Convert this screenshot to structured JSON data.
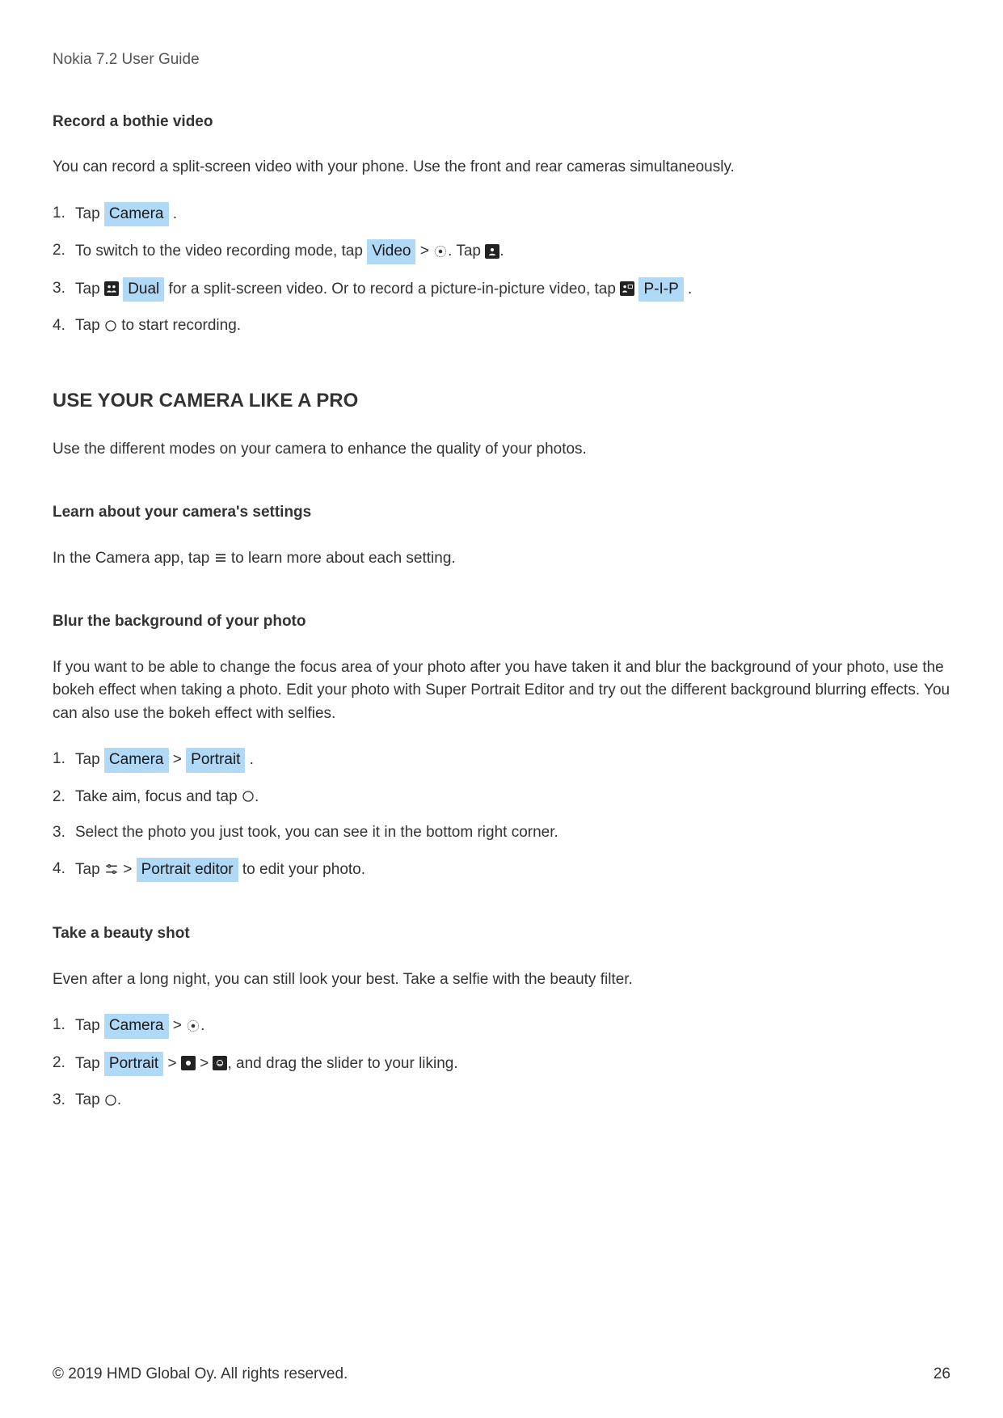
{
  "header": {
    "guide_title": "Nokia 7.2 User Guide"
  },
  "section_bothie": {
    "title": "Record a bothie video",
    "intro": "You can record a split-screen video with your phone. Use the front and rear cameras simultaneously.",
    "step1_tap": "Tap ",
    "step1_chip": "Camera",
    "step1_end": " .",
    "step2_pre": "To switch to the video recording mode, tap ",
    "step2_chip": "Video",
    "step2_mid": " > ",
    "step2_tap": ". Tap ",
    "step2_end": ".",
    "step3_pre": "Tap ",
    "step3_chip1": "Dual",
    "step3_mid": " for a split-screen video. Or to record a picture-in-picture video, tap ",
    "step3_chip2": "P-I-P",
    "step3_end": " .",
    "step4_pre": "Tap ",
    "step4_end": " to start recording."
  },
  "section_pro": {
    "title": "USE YOUR CAMERA LIKE A PRO",
    "intro": "Use the different modes on your camera to enhance the quality of your photos."
  },
  "section_settings": {
    "title": "Learn about your camera's settings",
    "line_pre": "In the Camera app, tap ",
    "line_post": " to learn more about each setting."
  },
  "section_blur": {
    "title": "Blur the background of your photo",
    "intro": "If you want to be able to change the focus area of your photo after you have taken it and blur the background of your photo, use the bokeh effect when taking a photo. Edit your photo with Super Portrait Editor and try out the different background blurring effects. You can also use the bokeh effect with selfies.",
    "step1_pre": "Tap ",
    "step1_chip1": "Camera",
    "step1_sep": " > ",
    "step1_chip2": "Portrait",
    "step1_end": " .",
    "step2_pre": "Take aim, focus and tap ",
    "step2_end": ".",
    "step3": "Select the photo you just took, you can see it in the bottom right corner.",
    "step4_pre": "Tap ",
    "step4_sep": " > ",
    "step4_chip": "Portrait editor",
    "step4_end": " to edit your photo."
  },
  "section_beauty": {
    "title": "Take a beauty shot",
    "intro": "Even after a long night, you can still look your best. Take a selfie with the beauty filter.",
    "step1_pre": "Tap ",
    "step1_chip": "Camera",
    "step1_sep": " > ",
    "step1_end": ".",
    "step2_pre": "Tap ",
    "step2_chip": "Portrait",
    "step2_sep1": " > ",
    "step2_sep2": " > ",
    "step2_end": ", and drag the slider to your liking.",
    "step3_pre": "Tap ",
    "step3_end": "."
  },
  "footer": {
    "copyright": "© 2019 HMD Global Oy. All rights reserved.",
    "page": "26"
  }
}
